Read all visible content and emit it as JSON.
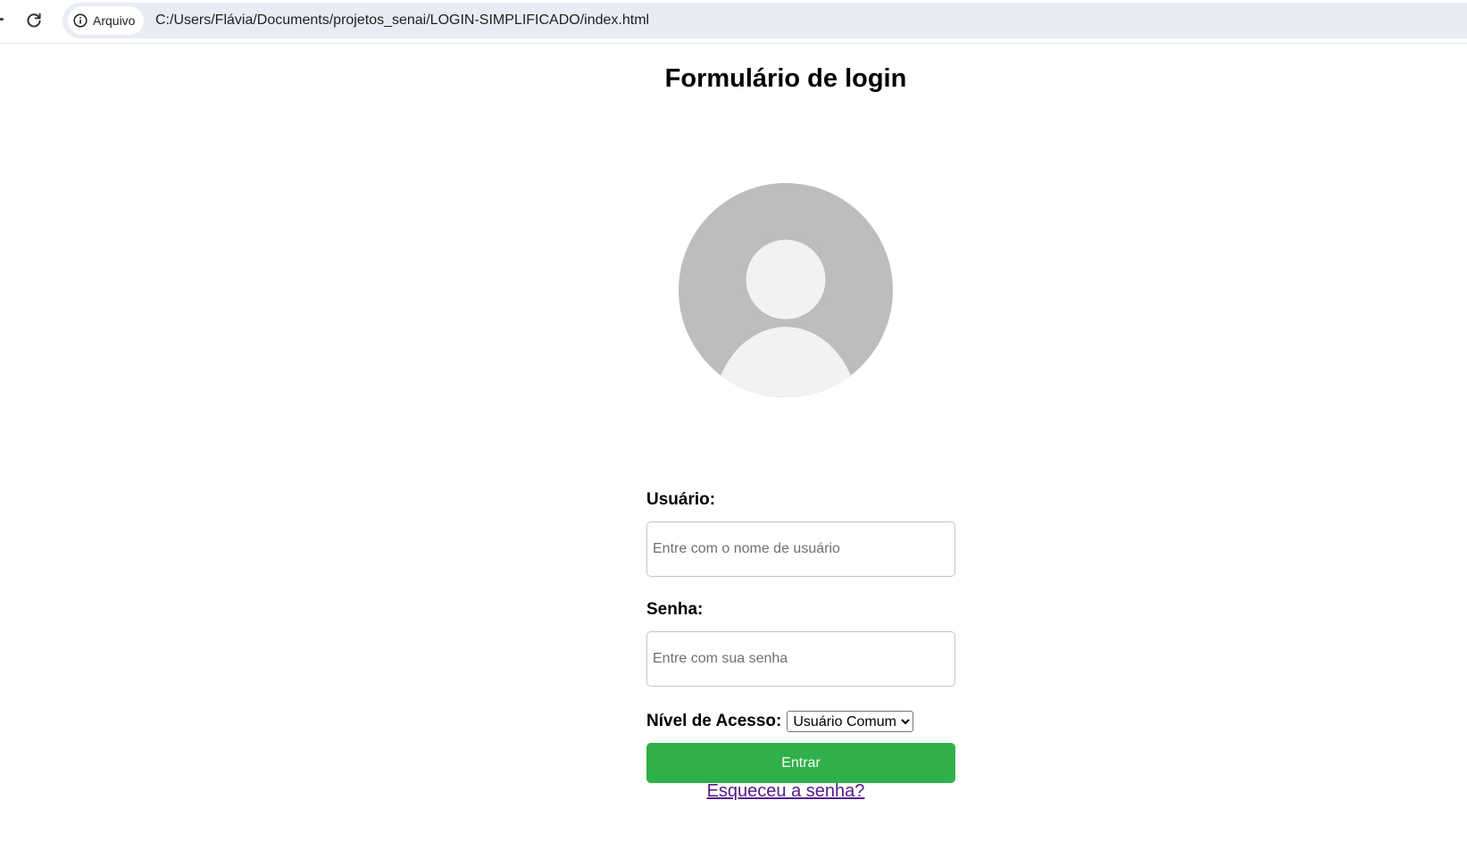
{
  "browser": {
    "site_chip_label": "Arquivo",
    "url": "C:/Users/Flávia/Documents/projetos_senai/LOGIN-SIMPLIFICADO/index.html"
  },
  "page": {
    "title": "Formulário de login"
  },
  "form": {
    "username_label": "Usuário:",
    "username_placeholder": "Entre com o nome de usuário",
    "username_value": "",
    "password_label": "Senha:",
    "password_placeholder": "Entre com sua senha",
    "password_value": "",
    "access_label": "Nível de Acesso:",
    "access_selected": "Usuário Comum",
    "submit_label": "Entrar",
    "forgot_link": "Esqueceu a senha?"
  },
  "colors": {
    "submit_bg": "#2fb04a",
    "link_visited": "#551a8b",
    "avatar_bg": "#bdbdbd",
    "avatar_fg": "#f2f2f2",
    "omnibox_bg": "#e9ecf5"
  },
  "icons": {
    "reload": "reload-icon",
    "site_info": "info-icon",
    "avatar": "user-avatar-icon",
    "dropdown": "chevron-down-icon"
  }
}
